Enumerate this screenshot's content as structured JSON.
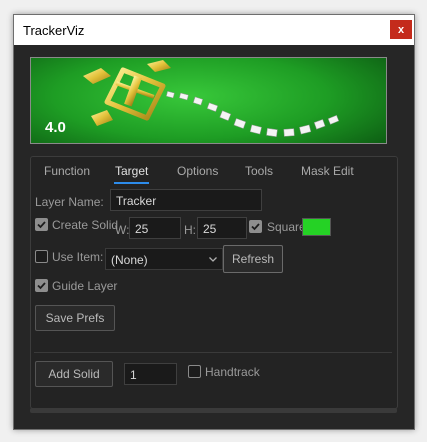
{
  "window": {
    "title": "TrackerViz",
    "close_glyph": "x"
  },
  "banner": {
    "version": "4.0",
    "logo": "tracker-target-logo"
  },
  "tabs": [
    {
      "label": "Function",
      "active": false
    },
    {
      "label": "Target",
      "active": true
    },
    {
      "label": "Options",
      "active": false
    },
    {
      "label": "Tools",
      "active": false
    },
    {
      "label": "Mask Edit",
      "active": false
    }
  ],
  "form": {
    "layer_name_label": "Layer Name:",
    "layer_name_value": "Tracker",
    "create_solid_label": "Create Solid",
    "create_solid_checked": true,
    "w_label": "W:",
    "w_value": "25",
    "h_label": "H:",
    "h_value": "25",
    "square_label": "Square",
    "square_checked": true,
    "solid_color": "#25d225",
    "use_item_label": "Use Item:",
    "use_item_checked": false,
    "use_item_selected": "(None)",
    "refresh_label": "Refresh",
    "guide_layer_label": "Guide Layer",
    "guide_layer_checked": true,
    "save_prefs_label": "Save Prefs",
    "add_solid_label": "Add Solid",
    "add_solid_count": "1",
    "handtrack_label": "Handtrack",
    "handtrack_checked": false
  },
  "colors": {
    "accent": "#2d8ceb",
    "panel_bg": "#262626",
    "banner_green": "#1e9d24"
  }
}
